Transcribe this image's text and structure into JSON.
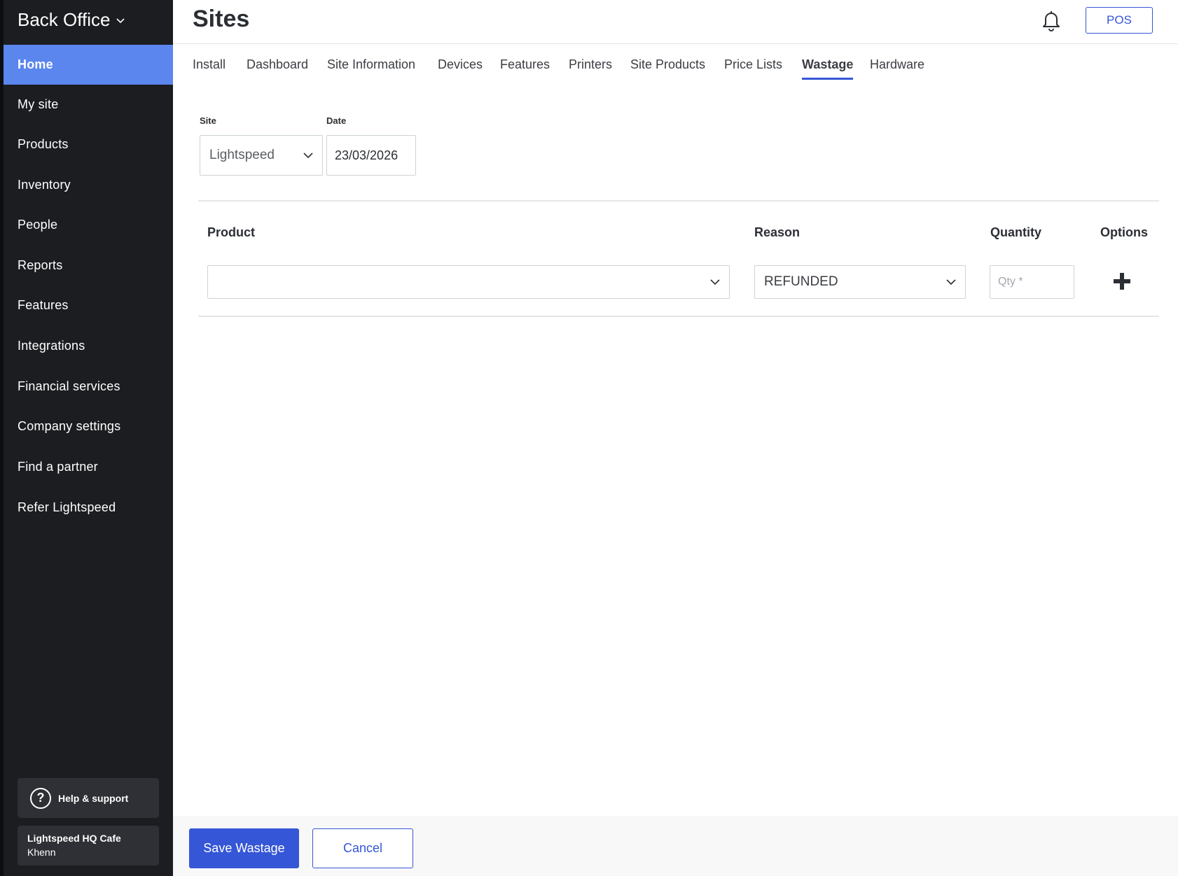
{
  "app": {
    "brand": "Back Office"
  },
  "sidebar": {
    "items": [
      {
        "label": "Home",
        "active": true
      },
      {
        "label": "My site"
      },
      {
        "label": "Products"
      },
      {
        "label": "Inventory"
      },
      {
        "label": "People"
      },
      {
        "label": "Reports"
      },
      {
        "label": "Features"
      },
      {
        "label": "Integrations"
      },
      {
        "label": "Financial services"
      },
      {
        "label": "Company settings"
      },
      {
        "label": "Find a partner"
      },
      {
        "label": "Refer Lightspeed"
      }
    ],
    "help": {
      "icon": "?",
      "label": "Help & support"
    },
    "account": {
      "name": "Lightspeed HQ Cafe",
      "user": "Khenn"
    }
  },
  "header": {
    "title": "Sites",
    "pos_label": "POS",
    "notification_icon": "bell-icon"
  },
  "tabs": [
    {
      "label": "Install"
    },
    {
      "label": "Dashboard"
    },
    {
      "label": "Site Information"
    },
    {
      "label": "Devices"
    },
    {
      "label": "Features"
    },
    {
      "label": "Printers"
    },
    {
      "label": "Site Products"
    },
    {
      "label": "Price Lists"
    },
    {
      "label": "Wastage",
      "active": true
    },
    {
      "label": "Hardware"
    }
  ],
  "filters": {
    "site": {
      "label": "Site",
      "value": "Lightspeed"
    },
    "date": {
      "label": "Date",
      "value": "23/03/2026"
    }
  },
  "table": {
    "columns": {
      "product": "Product",
      "reason": "Reason",
      "quantity": "Quantity",
      "options": "Options"
    },
    "row": {
      "product": "",
      "reason": "REFUNDED",
      "quantity_placeholder": "Qty *"
    }
  },
  "footer": {
    "save_label": "Save Wastage",
    "cancel_label": "Cancel"
  },
  "colors": {
    "accent": "#3556d6",
    "active_nav": "#5b86ee",
    "sidebar_bg": "#1c1d21"
  }
}
